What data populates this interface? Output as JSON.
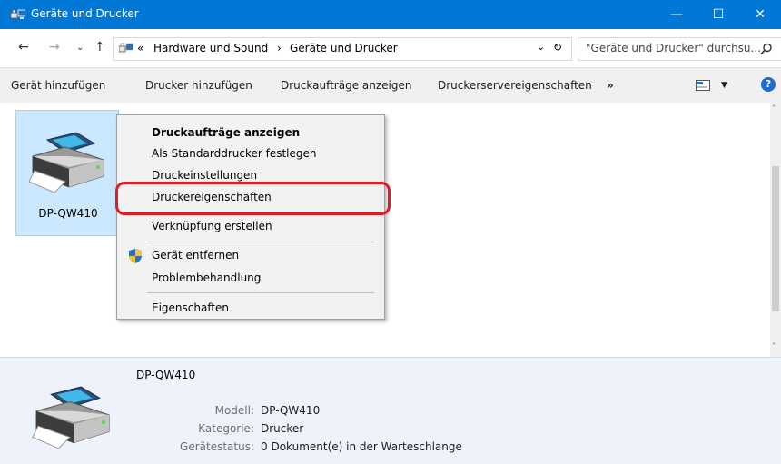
{
  "window": {
    "title": "Geräte und Drucker",
    "controls": {
      "minimize": "—",
      "maximize": "☐",
      "close": "✕"
    }
  },
  "address": {
    "overflow": "«",
    "crumbs": [
      "Hardware und Sound",
      "Geräte und Drucker"
    ],
    "separator": "›",
    "search_placeholder": "\"Geräte und Drucker\" durchsu..."
  },
  "commands": [
    "Gerät hinzufügen",
    "Drucker hinzufügen",
    "Druckaufträge anzeigen",
    "Druckerservereigenschaften",
    "»"
  ],
  "help": "?",
  "device": {
    "name": "DP-QW410",
    "icon": "printer-icon"
  },
  "context_menu": [
    {
      "label": "Druckaufträge anzeigen",
      "bold": true
    },
    {
      "label": "Als Standarddrucker festlegen"
    },
    {
      "label": "Druckeinstellungen"
    },
    {
      "label": "Druckereigenschaften",
      "highlighted": true
    },
    {
      "label": "Verknüpfung erstellen"
    },
    {
      "label": "Gerät entfernen",
      "icon": "shield-icon"
    },
    {
      "label": "Problembehandlung"
    },
    {
      "label": "Eigenschaften"
    }
  ],
  "details": {
    "title": "DP-QW410",
    "fields": [
      {
        "label": "Modell:",
        "value": "DP-QW410"
      },
      {
        "label": "Kategorie:",
        "value": "Drucker"
      },
      {
        "label": "Gerätestatus:",
        "value": "0 Dokument(e) in der Warteschlange"
      }
    ]
  },
  "colors": {
    "accent": "#0078d7",
    "selection": "#cce8ff",
    "highlight": "#e31b23"
  }
}
